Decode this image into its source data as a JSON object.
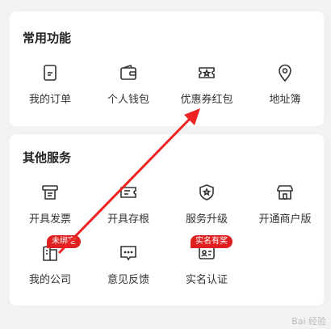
{
  "common": {
    "title": "常用功能",
    "items": [
      {
        "label": "我的订单",
        "icon": "order-icon"
      },
      {
        "label": "个人钱包",
        "icon": "wallet-icon"
      },
      {
        "label": "优惠券红包",
        "icon": "coupon-icon"
      },
      {
        "label": "地址簿",
        "icon": "location-icon"
      }
    ]
  },
  "other": {
    "title": "其他服务",
    "items": [
      {
        "label": "开具发票",
        "icon": "invoice-icon"
      },
      {
        "label": "开具存根",
        "icon": "stub-icon"
      },
      {
        "label": "服务升级",
        "icon": "upgrade-icon"
      },
      {
        "label": "开通商户版",
        "icon": "store-icon"
      },
      {
        "label": "我的公司",
        "icon": "company-icon",
        "badge": "未绑定"
      },
      {
        "label": "意见反馈",
        "icon": "feedback-icon"
      },
      {
        "label": "实名认证",
        "icon": "id-card-icon",
        "badge": "实名有奖"
      }
    ]
  },
  "watermark": "Bai 经验",
  "colors": {
    "badge": "#e02020",
    "arrow": "#ee2222",
    "background": "#f2f2f2"
  }
}
